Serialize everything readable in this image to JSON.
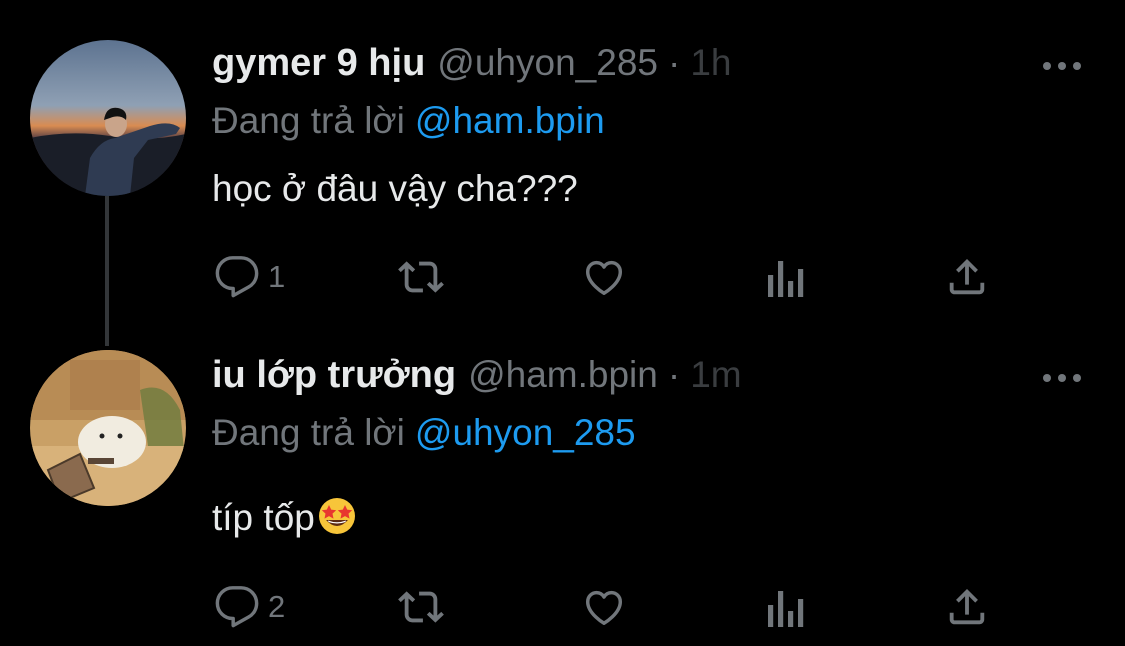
{
  "tweets": [
    {
      "display_name": "gymer 9 hịu",
      "handle": "@uhyon_285",
      "separator": "·",
      "time": "1h",
      "replying_prefix": "Đang trả lời",
      "replying_to": "@ham.bpin",
      "text": "học ở đâu vậy cha???",
      "reply_count": "1",
      "avatar": "person-sunset-photo"
    },
    {
      "display_name": "iu lớp trưởng",
      "handle": "@ham.bpin",
      "separator": "·",
      "time": "1m",
      "replying_prefix": "Đang trả lời",
      "replying_to": "@uhyon_285",
      "text": "típ tốp",
      "text_emoji": "star-struck-emoji",
      "reply_count": "2",
      "avatar": "hamster-illustration"
    }
  ],
  "colors": {
    "background": "#000000",
    "text": "#e7e9ea",
    "secondary": "#71767b",
    "accent": "#1d9bf0",
    "thread_line": "#333639"
  },
  "icons": [
    "reply-icon",
    "retweet-icon",
    "like-icon",
    "analytics-icon",
    "share-icon",
    "more-icon"
  ]
}
